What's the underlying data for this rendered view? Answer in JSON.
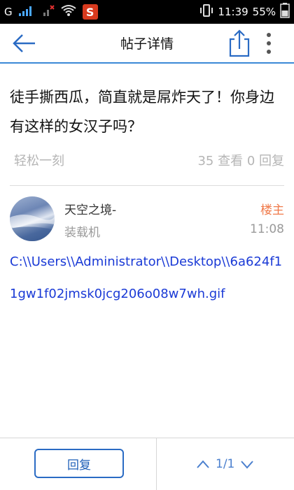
{
  "status_bar": {
    "time": "11:39",
    "battery": "55%",
    "network_label": "G",
    "app_badge": "S"
  },
  "nav": {
    "title": "帖子详情"
  },
  "post": {
    "title": "徒手撕西瓜，简直就是屌炸天了！你身边有这样的女汉子吗？",
    "category": "轻松一刻",
    "stats": "35 查看 0 回复"
  },
  "reply": {
    "username": "天空之境-",
    "owner_badge": "楼主",
    "user_title": "装载机",
    "time": "11:08",
    "content": "C:\\\\Users\\\\Administrator\\\\Desktop\\\\6a624f11gw1f02jmsk0jcg206o08w7wh.gif"
  },
  "bottom": {
    "reply_label": "回复",
    "page_indicator": "1/1"
  },
  "colors": {
    "accent": "#3a89d6",
    "owner": "#f07a4a",
    "link": "#1a3ad6"
  }
}
